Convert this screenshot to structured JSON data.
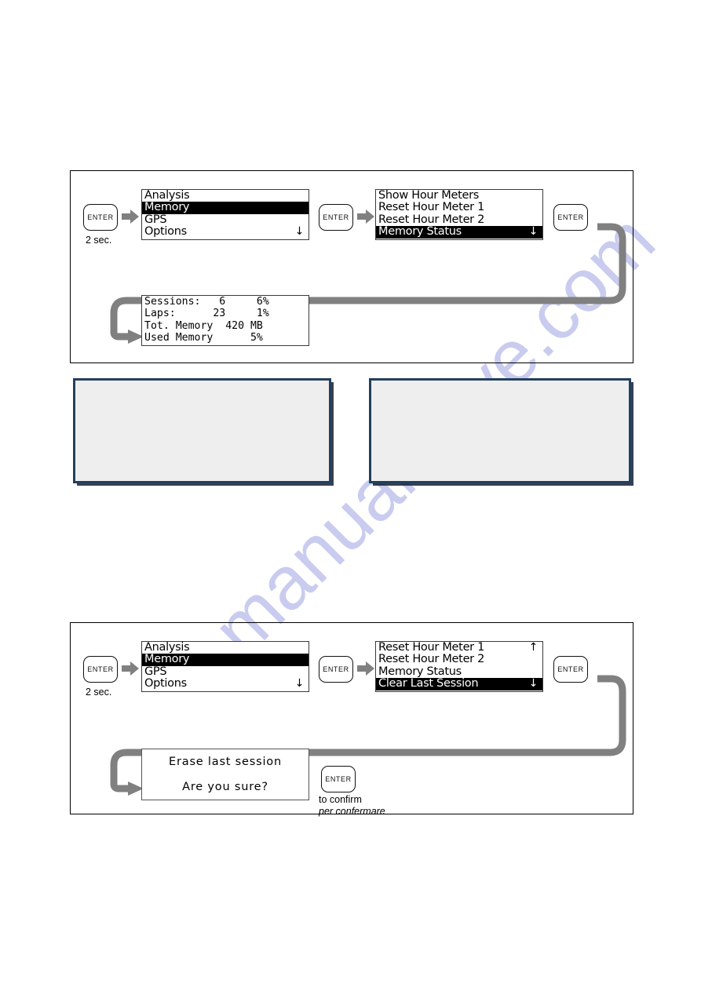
{
  "watermark": {
    "text": "manualshive.com",
    "color": "#c9ccef"
  },
  "colors": {
    "lcd_background": "#ffffff",
    "lcd_selected_background": "#000000",
    "lcd_selected_text": "#ffffff",
    "connector_gray": "#808080",
    "navy_border": "#22405e",
    "navy_fill": "#eeeeee"
  },
  "icons": {
    "arrow_down": "↓",
    "arrow_up": "↑",
    "block_arrow_right": "block-arrow-right-icon"
  },
  "section_memory_status": {
    "enter_key_1": {
      "label": "ENTER",
      "hold": "2 sec."
    },
    "enter_key_2": {
      "label": "ENTER"
    },
    "enter_key_3": {
      "label": "ENTER"
    },
    "menu_main": {
      "rows": [
        {
          "text": "Analysis",
          "selected": false,
          "arrow": ""
        },
        {
          "text": "Memory",
          "selected": true,
          "arrow": ""
        },
        {
          "text": "GPS",
          "selected": false,
          "arrow": ""
        },
        {
          "text": "Options",
          "selected": false,
          "arrow": "↓"
        }
      ]
    },
    "menu_memory": {
      "rows": [
        {
          "text": "Show Hour Meters",
          "selected": false,
          "arrow": ""
        },
        {
          "text": "Reset Hour Meter 1",
          "selected": false,
          "arrow": ""
        },
        {
          "text": "Reset Hour Meter 2",
          "selected": false,
          "arrow": ""
        },
        {
          "text": "Memory Status",
          "selected": true,
          "arrow": "↓"
        }
      ]
    },
    "memory_status_display": {
      "rows": [
        "Sessions:   6     6%",
        "Laps:      23     1%",
        "Tot. Memory  420 MB",
        "Used Memory      5%"
      ],
      "fields": [
        {
          "label": "Sessions:",
          "value": "6",
          "percent": "6%"
        },
        {
          "label": "Laps:",
          "value": "23",
          "percent": "1%"
        },
        {
          "label": "Tot. Memory",
          "value": "420 MB",
          "percent": ""
        },
        {
          "label": "Used Memory",
          "value": "",
          "percent": "5%"
        }
      ]
    }
  },
  "section_clear_last_session": {
    "enter_key_1": {
      "label": "ENTER",
      "hold": "2 sec."
    },
    "enter_key_2": {
      "label": "ENTER"
    },
    "enter_key_3": {
      "label": "ENTER"
    },
    "enter_key_confirm": {
      "label": "ENTER"
    },
    "menu_main": {
      "rows": [
        {
          "text": "Analysis",
          "selected": false,
          "arrow": ""
        },
        {
          "text": "Memory",
          "selected": true,
          "arrow": ""
        },
        {
          "text": "GPS",
          "selected": false,
          "arrow": ""
        },
        {
          "text": "Options",
          "selected": false,
          "arrow": "↓"
        }
      ]
    },
    "menu_memory": {
      "rows": [
        {
          "text": "Reset Hour Meter 1",
          "selected": false,
          "arrow": "↑"
        },
        {
          "text": "Reset Hour Meter 2",
          "selected": false,
          "arrow": ""
        },
        {
          "text": "Memory Status",
          "selected": false,
          "arrow": ""
        },
        {
          "text": "Clear Last Session",
          "selected": true,
          "arrow": "↓"
        }
      ]
    },
    "confirm_dialog": {
      "line1": "Erase last session",
      "line2": "Are you sure?"
    },
    "confirm_caption": {
      "english": "to confirm",
      "italian": "per confermare"
    }
  }
}
